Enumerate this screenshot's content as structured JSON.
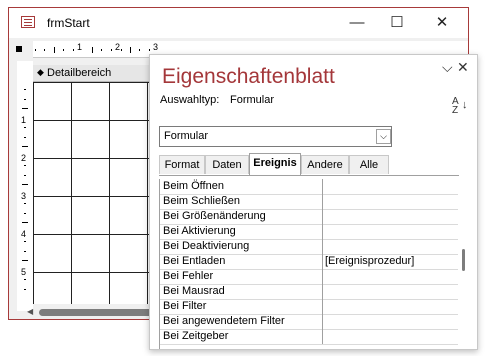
{
  "form_window": {
    "title": "frmStart",
    "minimize_glyph": "—",
    "maximize_glyph": "☐",
    "close_glyph": "✕",
    "ruler_numbers": [
      "1",
      "2",
      "3",
      "4",
      "5"
    ],
    "vruler_numbers": [
      "1",
      "2",
      "3",
      "4",
      "5",
      "6",
      "7"
    ],
    "section_label": "Detailbereich",
    "accent_color": "#a73a3a"
  },
  "property_sheet": {
    "title": "Eigenschaftenblatt",
    "selection_type_label": "Auswahltyp:",
    "selection_type_value": "Formular",
    "combo_value": "Formular",
    "tabs": [
      "Format",
      "Daten",
      "Ereignis",
      "Andere",
      "Alle"
    ],
    "active_tab": "Ereignis",
    "rows": [
      {
        "name": "Beim Öffnen",
        "value": ""
      },
      {
        "name": "Beim Schließen",
        "value": ""
      },
      {
        "name": "Bei Größenänderung",
        "value": ""
      },
      {
        "name": "Bei Aktivierung",
        "value": ""
      },
      {
        "name": "Bei Deaktivierung",
        "value": ""
      },
      {
        "name": "Bei Entladen",
        "value": "[Ereignisprozedur]"
      },
      {
        "name": "Bei Fehler",
        "value": ""
      },
      {
        "name": "Bei Mausrad",
        "value": ""
      },
      {
        "name": "Bei Filter",
        "value": ""
      },
      {
        "name": "Bei angewendetem Filter",
        "value": ""
      },
      {
        "name": "Bei Zeitgeber",
        "value": ""
      }
    ],
    "title_color": "#a4373a",
    "sort_icon": "A-Z sort"
  }
}
